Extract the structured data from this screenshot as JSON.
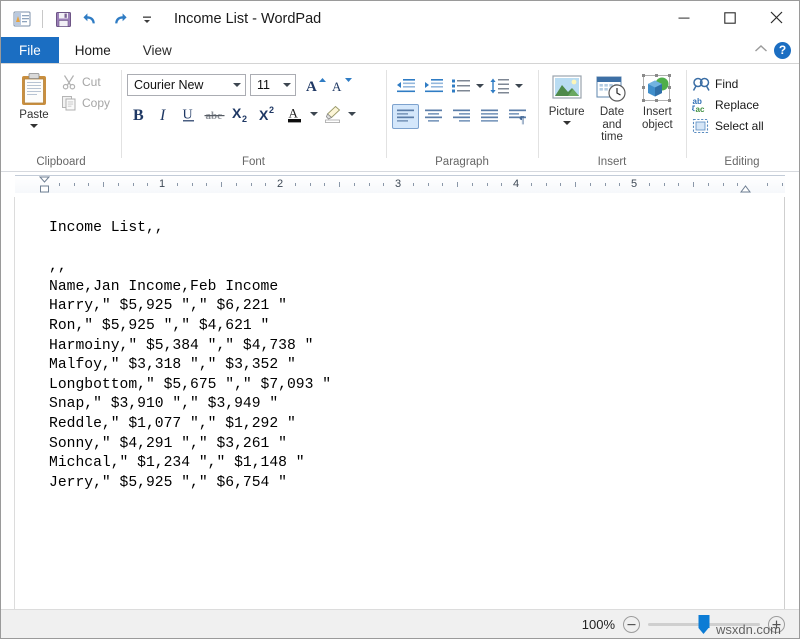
{
  "window": {
    "title": "Income List - WordPad",
    "app_icon": "wordpad-icon",
    "quick_access": [
      {
        "name": "save-icon",
        "label": "Save"
      },
      {
        "name": "undo-icon",
        "label": "Undo"
      },
      {
        "name": "redo-icon",
        "label": "Redo"
      },
      {
        "name": "customize-quick-access-icon",
        "label": "Customize Quick Access Toolbar"
      }
    ],
    "controls": {
      "minimize": "Minimize",
      "maximize": "Maximize",
      "close": "Close"
    }
  },
  "tabs": [
    {
      "label": "File",
      "state": "file"
    },
    {
      "label": "Home",
      "state": "active"
    },
    {
      "label": "View",
      "state": "inactive"
    }
  ],
  "ribbon_controls": {
    "collapse_label": "Collapse the Ribbon",
    "help_label": "?"
  },
  "ribbon": {
    "clipboard": {
      "label": "Clipboard",
      "paste": "Paste",
      "cut": "Cut",
      "copy": "Copy"
    },
    "font": {
      "label": "Font",
      "font_family": "Courier New",
      "font_size": "11",
      "grow_font": "Grow font",
      "shrink_font": "Shrink font",
      "bold": "B",
      "italic": "I",
      "underline": "U",
      "strikethrough": "abc",
      "subscript": "X₂",
      "superscript": "X²",
      "text_color": "Text color",
      "highlight": "Text highlight color"
    },
    "paragraph": {
      "label": "Paragraph",
      "decrease_indent": "Decrease indent",
      "increase_indent": "Increase indent",
      "bullets": "Start a list",
      "line_spacing": "Line spacing",
      "align_left": "Align left",
      "align_center": "Center",
      "align_right": "Align right",
      "justify": "Justify",
      "paragraph_settings": "Paragraph settings",
      "selected_alignment": "align_left"
    },
    "insert": {
      "label": "Insert",
      "picture": "Picture",
      "date_and_time_line1": "Date and",
      "date_and_time_line2": "time",
      "insert_object_line1": "Insert",
      "insert_object_line2": "object"
    },
    "editing": {
      "label": "Editing",
      "find": "Find",
      "replace": "Replace",
      "select_all": "Select all"
    }
  },
  "ruler": {
    "numbers": [
      "1",
      "2",
      "3",
      "4",
      "5"
    ],
    "left_indent_marker": "left-indent-marker",
    "right_indent_marker": "right-indent-marker"
  },
  "document": {
    "lines": [
      "Income List,,",
      "",
      ",,",
      "Name,Jan Income,Feb Income",
      "Harry,\" $5,925 \",\" $6,221 \"",
      "Ron,\" $5,925 \",\" $4,621 \"",
      "Harmoiny,\" $5,384 \",\" $4,738 \"",
      "Malfoy,\" $3,318 \",\" $3,352 \"",
      "Longbottom,\" $5,675 \",\" $7,093 \"",
      "Snap,\" $3,910 \",\" $3,949 \"",
      "Reddle,\" $1,077 \",\" $1,292 \"",
      "Sonny,\" $4,291 \",\" $3,261 \"",
      "Michcal,\" $1,234 \",\" $1,148 \"",
      "Jerry,\" $5,925 \",\" $6,754 \""
    ]
  },
  "statusbar": {
    "zoom_percent": "100%",
    "zoom_out": "Zoom out",
    "zoom_in": "Zoom in",
    "zoom_slider_value": 50
  },
  "watermark": "wsxdn.com",
  "colors": {
    "accent_blue": "#1b6ec2",
    "ribbon_icon_blue": "#2b6fb5",
    "selected_button": "#d4e7fb",
    "zoom_handle": "#0c7cd5"
  }
}
